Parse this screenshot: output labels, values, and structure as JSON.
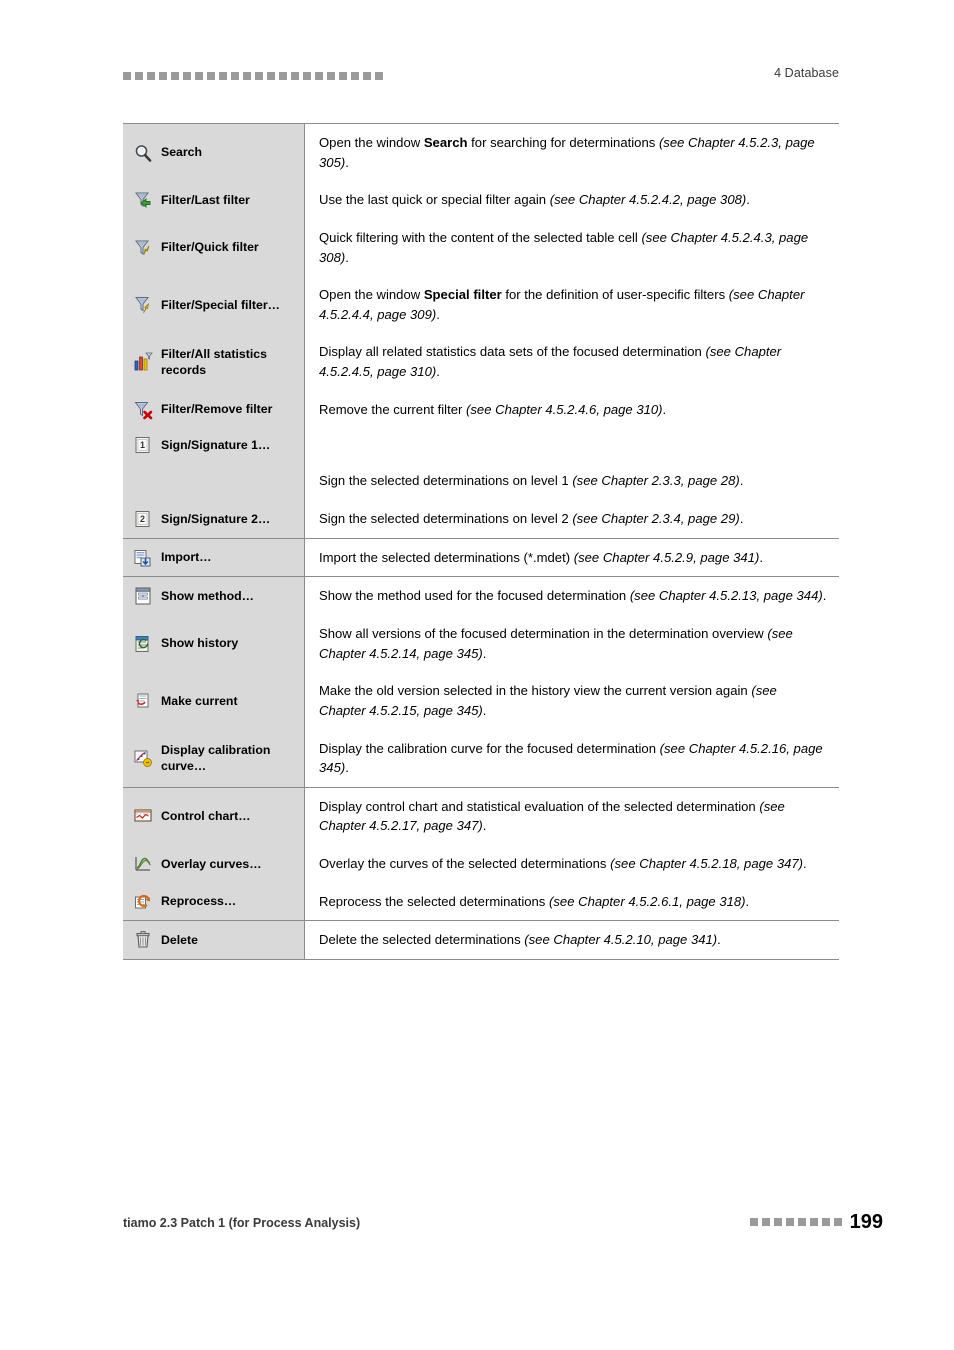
{
  "header": {
    "chapter": "4 Database",
    "dot_count": 22
  },
  "footer": {
    "product": "tiamo 2.3 Patch 1 (for Process Analysis)",
    "page_number": "199",
    "dot_count": 8
  },
  "groups": [
    {
      "rows": [
        {
          "icon": "magnifier-search-icon",
          "label": "Search",
          "desc_html": "Open the window <b>Search</b> for searching for determinations <i>(see Chapter 4.5.2.3, page 305)</i>."
        },
        {
          "icon": "filter-last-filter-icon",
          "label": "Filter/Last filter",
          "desc_html": "Use the last quick or special filter again <i>(see Chapter 4.5.2.4.2, page 308)</i>."
        },
        {
          "icon": "filter-quick-filter-icon",
          "label": "Filter/Quick filter",
          "desc_html": "Quick filtering with the content of the selected table cell <i>(see Chapter 4.5.2.4.3, page 308)</i>."
        },
        {
          "icon": "filter-special-filter-icon",
          "label": "Filter/Special filter…",
          "desc_html": "Open the window <b>Special filter</b> for the definition of user-specific filters <i>(see Chapter 4.5.2.4.4, page 309)</i>."
        },
        {
          "icon": "filter-all-statistics-records-icon",
          "label": "Filter/All statistics records",
          "desc_html": "Display all related statistics data sets of the focused determination <i>(see Chapter 4.5.2.4.5, page 310)</i>."
        },
        {
          "icon": "filter-remove-filter-icon",
          "label": "Filter/Remove filter",
          "desc_html": "Remove the current filter <i>(see Chapter 4.5.2.4.6, page 310)</i>."
        },
        {
          "icon": "sign-signature-1-icon",
          "label": "Sign/Signature 1…",
          "desc_html": ""
        },
        {
          "icon": "",
          "label": "",
          "desc_html": "Sign the selected determinations on level 1 <i>(see Chapter 2.3.3, page 28)</i>."
        },
        {
          "icon": "sign-signature-2-icon",
          "label": "Sign/Signature 2…",
          "desc_html": "Sign the selected determinations on level 2 <i>(see Chapter 2.3.4, page 29)</i>."
        }
      ]
    },
    {
      "rows": [
        {
          "icon": "import-icon",
          "label": "Import…",
          "desc_html": "Import the selected determinations (*.mdet) <i>(see Chapter 4.5.2.9, page 341)</i>."
        }
      ]
    },
    {
      "rows": [
        {
          "icon": "show-method-icon",
          "label": "Show method…",
          "desc_html": "Show the method used for the focused determination <i>(see Chapter 4.5.2.13, page 344)</i>."
        },
        {
          "icon": "show-history-icon",
          "label": "Show history",
          "desc_html": "Show all versions of the focused determination in the determination overview <i>(see Chapter 4.5.2.14, page 345)</i>."
        },
        {
          "icon": "make-current-icon",
          "label": "Make current",
          "desc_html": "Make the old version selected in the history view the current version again <i>(see Chapter 4.5.2.15, page 345)</i>."
        },
        {
          "icon": "display-calibration-curve-icon",
          "label": "Display calibration curve…",
          "desc_html": "Display the calibration curve for the focused determination <i>(see Chapter 4.5.2.16, page 345)</i>."
        }
      ]
    },
    {
      "rows": [
        {
          "icon": "control-chart-icon",
          "label": "Control chart…",
          "desc_html": "Display control chart and statistical evaluation of the selected determination <i>(see Chapter 4.5.2.17, page 347)</i>."
        },
        {
          "icon": "overlay-curves-icon",
          "label": "Overlay curves…",
          "desc_html": "Overlay the curves of the selected determinations <i>(see Chapter 4.5.2.18, page 347)</i>."
        },
        {
          "icon": "reprocess-icon",
          "label": "Reprocess…",
          "desc_html": "Reprocess the selected determinations <i>(see Chapter 4.5.2.6.1, page 318)</i>."
        }
      ]
    },
    {
      "rows": [
        {
          "icon": "delete-trash-icon",
          "label": "Delete",
          "desc_html": "Delete the selected determinations <i>(see Chapter 4.5.2.10, page 341)</i>."
        }
      ]
    }
  ]
}
